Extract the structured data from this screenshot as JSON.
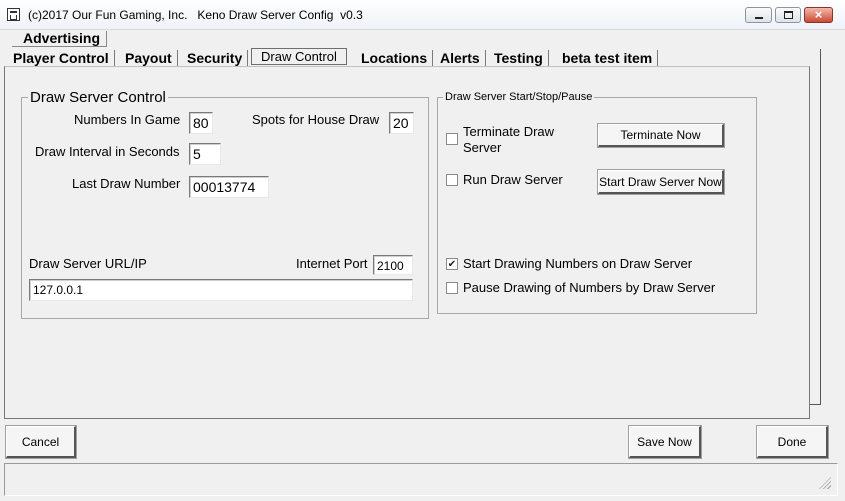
{
  "window": {
    "title": "(c)2017 Our Fun Gaming, Inc.   Keno Draw Server Config  v0.3",
    "min_glyph": "minimize",
    "max_glyph": "maximize",
    "close_glyph": "×"
  },
  "tabs": {
    "row1": [
      "Advertising"
    ],
    "row2": [
      "Player Control",
      "Payout",
      "Security",
      "Draw Control",
      "Locations",
      "Alerts",
      "Testing",
      "beta test item"
    ],
    "active": "Draw Control"
  },
  "draw_server_control": {
    "legend": "Draw Server Control",
    "numbers_in_game_label": "Numbers In Game",
    "numbers_in_game": "80",
    "spots_label": "Spots for House Draw",
    "spots": "20",
    "interval_label": "Draw Interval in Seconds",
    "interval": "5",
    "last_draw_label": "Last Draw Number",
    "last_draw": "00013774",
    "url_label": "Draw Server URL/IP",
    "url": "127.0.0.1",
    "port_label": "Internet Port",
    "port": "2100"
  },
  "start_stop": {
    "legend": "Draw Server Start/Stop/Pause",
    "terminate_label_line1": "Terminate Draw",
    "terminate_label_line2": "Server",
    "terminate_checked": false,
    "terminate_button": "Terminate Now",
    "run_label": "Run Draw Server",
    "run_checked": false,
    "start_button": "Start Draw Server Now",
    "start_drawing_label": "Start Drawing Numbers on Draw Server",
    "start_drawing_checked": true,
    "pause_label": "Pause Drawing of Numbers by Draw Server",
    "pause_checked": false
  },
  "footer": {
    "cancel": "Cancel",
    "save": "Save Now",
    "done": "Done"
  }
}
